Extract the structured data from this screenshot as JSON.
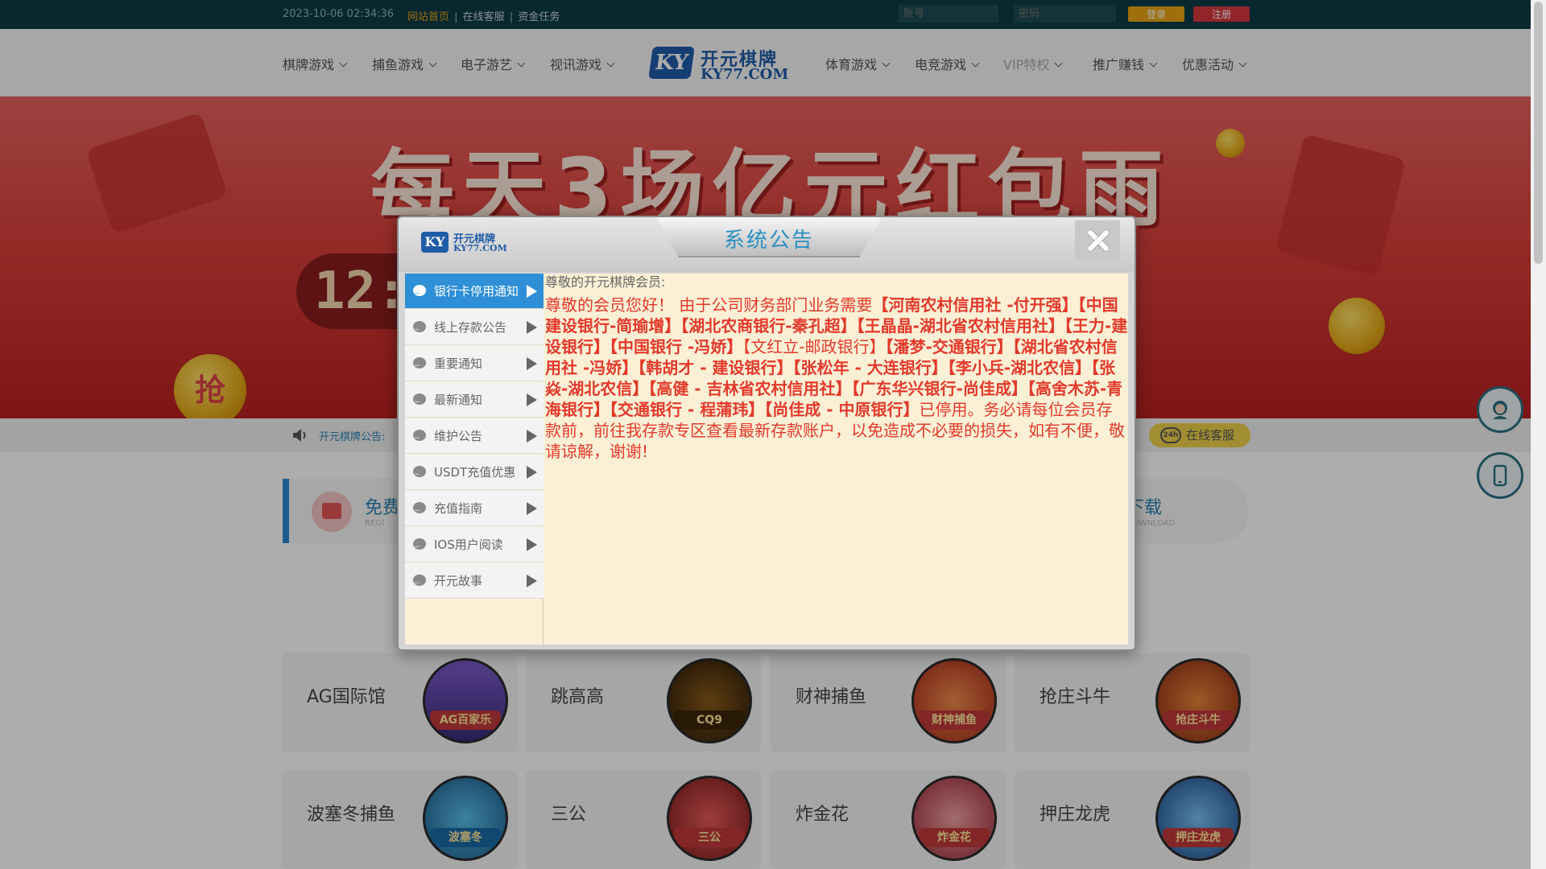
{
  "topbar": {
    "datetime": "2023-10-06 02:34:36",
    "links": [
      "网站首页",
      "在线客服",
      "资金任务"
    ],
    "account_placeholder": "账号",
    "password_placeholder": "密码",
    "login_label": "登录",
    "register_label": "注册"
  },
  "nav": {
    "left": [
      "棋牌游戏",
      "捕鱼游戏",
      "电子游艺",
      "视讯游戏"
    ],
    "right": [
      "体育游戏",
      "电竞游戏",
      "VIP特权",
      "推广赚钱",
      "优惠活动"
    ],
    "logo_mark": "KY",
    "logo_cn": "开元棋牌",
    "logo_en": "KY77.COM"
  },
  "banner": {
    "headline": "每天3场亿元红包雨",
    "clock": "12:0",
    "grab": "抢"
  },
  "notice": {
    "label": "开元棋牌公告:",
    "customer_service": "在线客服",
    "cs_badge": "24h"
  },
  "quick": {
    "left_title": "免费",
    "left_sub": "REGI",
    "right_title": "下载",
    "right_sub": "DOWNLOAD"
  },
  "games": [
    {
      "name": "AG国际馆",
      "tag": "AG百家乐"
    },
    {
      "name": "跳高高",
      "tag": "CQ9"
    },
    {
      "name": "财神捕鱼",
      "tag": "财神捕鱼"
    },
    {
      "name": "抢庄斗牛",
      "tag": "抢庄斗牛"
    },
    {
      "name": "波塞冬捕鱼",
      "tag": "波塞冬"
    },
    {
      "name": "三公",
      "tag": "三公"
    },
    {
      "name": "炸金花",
      "tag": "炸金花"
    },
    {
      "name": "押庄龙虎",
      "tag": "押庄龙虎"
    }
  ],
  "modal": {
    "logo_mark": "KY",
    "logo_cn": "开元棋牌",
    "logo_en": "KY77.COM",
    "title": "系统公告",
    "tabs": [
      "银行卡停用通知",
      "线上存款公告",
      "重要通知",
      "最新通知",
      "维护公告",
      "USDT充值优惠",
      "充值指南",
      "IOS用户阅读",
      "开元故事"
    ],
    "active_tab": 0,
    "greeting": "尊敬的开元棋牌会员:",
    "intro": "尊敬的会员您好！ 由于公司财务部门业务需要",
    "banks_1": "【河南农村信用社 -付开强】【中国建设银行-简瑜增】【湖北农商银行-秦孔超】【王晶晶-湖北省农村信用社】【王力-建设银行】【中国银行 -冯娇】",
    "banks_plain": "【文红立-邮政银行】",
    "banks_2": "【潘梦-交通银行】【湖北省农村信用社 -冯娇】【韩胡才 - 建设银行】【张松年 - 大连银行】【李小兵-湖北农信】【张焱-湖北农信】【高健 - 吉林省农村信用社】【广东华兴银行-尚佳成】【高舍木苏-青海银行】【交通银行 - 程蒲玮】【尚佳成 - 中原银行】",
    "outro": "已停用。务必请每位会员存款前，前往我存款专区查看最新存款账户，以免造成不必要的损失，如有不便，敬请谅解，谢谢!"
  },
  "colors": {
    "topbar": "#0d3b47",
    "accent_blue": "#2e8fd6",
    "notice_red": "#e23a2c",
    "content_bg": "#fbf0d6"
  }
}
